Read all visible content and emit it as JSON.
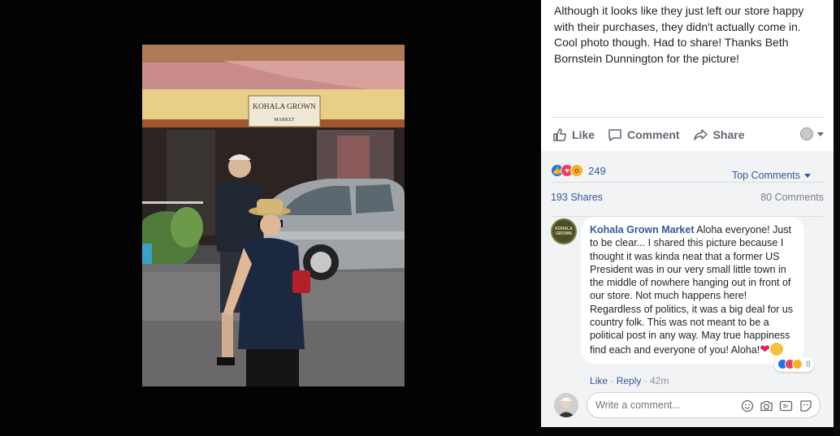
{
  "post": {
    "text": "Although it looks like they just left our store happy with their purchases, they didn't actually come in. Cool photo though. Had to share! Thanks Beth Bornstein Dunnington for the picture!"
  },
  "actions": {
    "like": "Like",
    "comment": "Comment",
    "share": "Share"
  },
  "photo": {
    "store_sign_line1": "KOHALA GROWN",
    "store_sign_line2": "MARKET"
  },
  "reactions": {
    "count": "249",
    "types": [
      "like-icon",
      "love-icon",
      "wow-icon"
    ],
    "sort_label": "Top Comments"
  },
  "stats": {
    "shares": "193 Shares",
    "comments": "80 Comments"
  },
  "comment": {
    "author": "Kohala Grown Market",
    "text": " Aloha everyone! Just to be clear... I shared this picture because I thought it was kinda neat that a former US President was in our very small little town in the middle of nowhere hanging out in front of our store. Not much happens here! Regardless of politics, it was a big deal for us country folk. This was not meant to be a political post in any way. May true happiness find each and everyone of you! Aloha!",
    "avatar_text": "KOHALA GROWN",
    "reaction_count": "8",
    "like_link": "Like",
    "reply_link": "Reply",
    "time": "42m"
  },
  "composer": {
    "placeholder": "Write a comment..."
  },
  "colors": {
    "link": "#365899",
    "like_blue": "#1877f2",
    "love_red": "#f33e58",
    "wow_yellow": "#f7b125"
  }
}
